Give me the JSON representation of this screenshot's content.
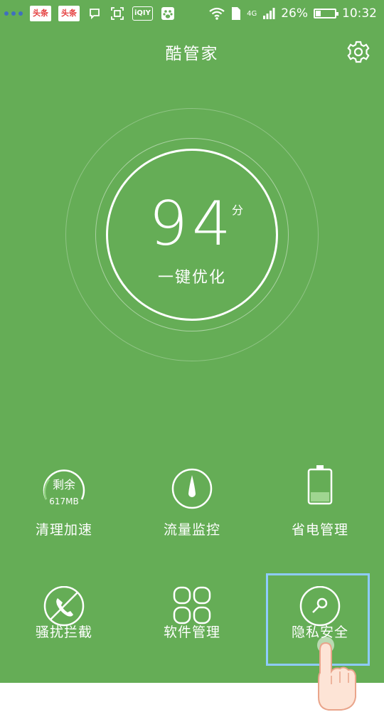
{
  "statusbar": {
    "news1": "头条",
    "news2": "头条",
    "iqiyi": "iQIY",
    "network": "4G",
    "battery_percent_label": "26%",
    "battery_level": 0.26,
    "time": "10:32"
  },
  "header": {
    "title": "酷管家",
    "settings_icon": "gear-icon"
  },
  "score": {
    "value": "94",
    "unit": "分",
    "action_label": "一键优化"
  },
  "tiles": [
    {
      "label": "清理加速",
      "icon": "memory-gauge-icon",
      "inner_label": "剩余",
      "sub_label": "617MB"
    },
    {
      "label": "流量监控",
      "icon": "traffic-drop-icon"
    },
    {
      "label": "省电管理",
      "icon": "battery-icon"
    },
    {
      "label": "骚扰拦截",
      "icon": "blocked-phone-icon"
    },
    {
      "label": "软件管理",
      "icon": "apps-grid-icon"
    },
    {
      "label": "隐私安全",
      "icon": "privacy-key-icon"
    }
  ],
  "colors": {
    "background": "#65ad56",
    "highlight": "#8ecbff"
  }
}
